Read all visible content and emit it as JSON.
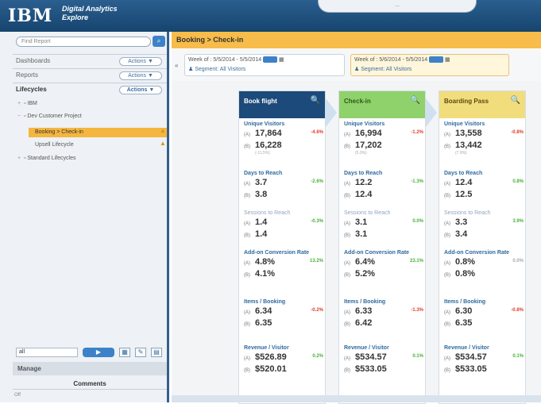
{
  "header": {
    "logo": "IBM",
    "product_line1": "Digital Analytics",
    "product_line2": "Explore",
    "topnav_label": "..."
  },
  "sidebar": {
    "search_placeholder": "Find Report",
    "search_button_icon": "search-icon",
    "sections": [
      {
        "label": "Dashboards",
        "action": "Actions ▼"
      },
      {
        "label": "Reports",
        "action": "Actions ▼"
      },
      {
        "label": "Lifecycles",
        "action": "Actions ▼"
      }
    ],
    "tree": [
      {
        "label": "IBM"
      },
      {
        "label": "Dev Customer Project"
      },
      {
        "label": "Booking > Check-in"
      },
      {
        "label": "Upsell Lifecycle"
      },
      {
        "label": "Standard Lifecycles"
      }
    ],
    "bottom_search": "all",
    "bottom_go": "▶",
    "tool_icons": [
      "grid-icon",
      "edit-icon",
      "delete-icon"
    ],
    "manage_label": "Manage",
    "comments_label": "Comments",
    "comments_footer": "Off"
  },
  "main": {
    "title": "Booking > Check-in",
    "segments": [
      {
        "week": "Week of : 5/5/2014 - 5/5/2014",
        "segment": "Segment: All Visitors"
      },
      {
        "week": "Week of : 5/6/2014 - 5/5/2014",
        "segment": "Segment: All Visitors"
      }
    ],
    "stages": [
      {
        "title": "Book flight",
        "color": "#1c4a7a",
        "text_color": "#ffffff",
        "metrics": [
          {
            "label": "Unique Visitors",
            "a": "17,864",
            "b": "16,228",
            "change": "-4.6%",
            "dir": "red",
            "sub": "(-11.5%)"
          },
          {
            "label": "Days to Reach",
            "a": "3.7",
            "b": "3.8",
            "change": "-2.6%",
            "dir": "green",
            "sub": ""
          },
          {
            "label": "Sessions to Reach",
            "a": "1.4",
            "b": "1.4",
            "change": "-0.3%",
            "dir": "green",
            "sub": ""
          },
          {
            "label": "Add-on Conversion Rate",
            "a": "4.8%",
            "b": "4.1%",
            "change": "13.2%",
            "dir": "green",
            "sub": ""
          },
          {
            "label": "Items / Booking",
            "a": "6.34",
            "b": "6.35",
            "change": "-0.2%",
            "dir": "red",
            "sub": ""
          },
          {
            "label": "Revenue / Visitor",
            "a": "$526.89",
            "b": "$520.01",
            "change": "0.2%",
            "dir": "green",
            "sub": ""
          }
        ]
      },
      {
        "title": "Check-in",
        "color": "#8fd16a",
        "text_color": "#2c5a18",
        "metrics": [
          {
            "label": "Unique Visitors",
            "a": "16,994",
            "b": "17,202",
            "change": "-1.2%",
            "dir": "red",
            "sub": "(5.0%)"
          },
          {
            "label": "Days to Reach",
            "a": "12.2",
            "b": "12.4",
            "change": "-1.3%",
            "dir": "green",
            "sub": ""
          },
          {
            "label": "Sessions to Reach",
            "a": "3.1",
            "b": "3.1",
            "change": "0.0%",
            "dir": "green",
            "sub": ""
          },
          {
            "label": "Add-on Conversion Rate",
            "a": "6.4%",
            "b": "5.2%",
            "change": "23.1%",
            "dir": "green",
            "sub": ""
          },
          {
            "label": "Items / Booking",
            "a": "6.33",
            "b": "6.42",
            "change": "-1.3%",
            "dir": "red",
            "sub": ""
          },
          {
            "label": "Revenue / Visitor",
            "a": "$534.57",
            "b": "$533.05",
            "change": "0.1%",
            "dir": "green",
            "sub": ""
          }
        ]
      },
      {
        "title": "Boarding Pass",
        "color": "#f2dd7c",
        "text_color": "#5a4a10",
        "metrics": [
          {
            "label": "Unique Visitors",
            "a": "13,558",
            "b": "13,442",
            "change": "-0.8%",
            "dir": "red",
            "sub": "(7.9%)"
          },
          {
            "label": "Days to Reach",
            "a": "12.4",
            "b": "12.5",
            "change": "0.8%",
            "dir": "green",
            "sub": ""
          },
          {
            "label": "Sessions to Reach",
            "a": "3.3",
            "b": "3.4",
            "change": "3.9%",
            "dir": "green",
            "sub": ""
          },
          {
            "label": "Add-on Conversion Rate",
            "a": "0.8%",
            "b": "0.8%",
            "change": "0.0%",
            "dir": "grey",
            "sub": ""
          },
          {
            "label": "Items / Booking",
            "a": "6.30",
            "b": "6.35",
            "change": "-0.8%",
            "dir": "red",
            "sub": ""
          },
          {
            "label": "Revenue / Visitor",
            "a": "$534.57",
            "b": "$533.05",
            "change": "0.1%",
            "dir": "green",
            "sub": ""
          }
        ]
      }
    ]
  }
}
